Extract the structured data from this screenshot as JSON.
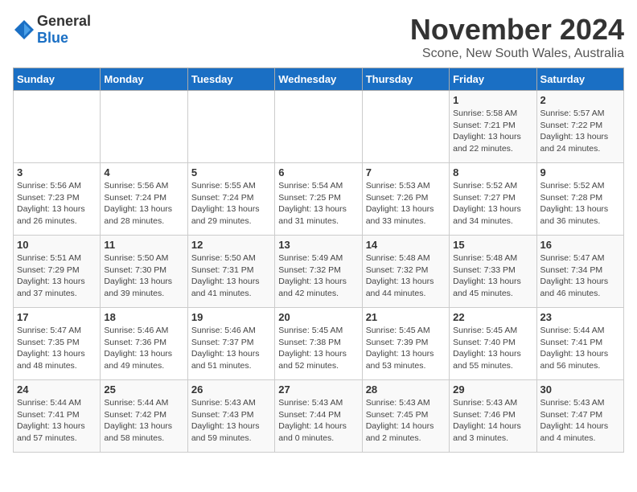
{
  "header": {
    "logo_general": "General",
    "logo_blue": "Blue",
    "month": "November 2024",
    "location": "Scone, New South Wales, Australia"
  },
  "weekdays": [
    "Sunday",
    "Monday",
    "Tuesday",
    "Wednesday",
    "Thursday",
    "Friday",
    "Saturday"
  ],
  "weeks": [
    [
      {
        "day": "",
        "info": ""
      },
      {
        "day": "",
        "info": ""
      },
      {
        "day": "",
        "info": ""
      },
      {
        "day": "",
        "info": ""
      },
      {
        "day": "",
        "info": ""
      },
      {
        "day": "1",
        "info": "Sunrise: 5:58 AM\nSunset: 7:21 PM\nDaylight: 13 hours\nand 22 minutes."
      },
      {
        "day": "2",
        "info": "Sunrise: 5:57 AM\nSunset: 7:22 PM\nDaylight: 13 hours\nand 24 minutes."
      }
    ],
    [
      {
        "day": "3",
        "info": "Sunrise: 5:56 AM\nSunset: 7:23 PM\nDaylight: 13 hours\nand 26 minutes."
      },
      {
        "day": "4",
        "info": "Sunrise: 5:56 AM\nSunset: 7:24 PM\nDaylight: 13 hours\nand 28 minutes."
      },
      {
        "day": "5",
        "info": "Sunrise: 5:55 AM\nSunset: 7:24 PM\nDaylight: 13 hours\nand 29 minutes."
      },
      {
        "day": "6",
        "info": "Sunrise: 5:54 AM\nSunset: 7:25 PM\nDaylight: 13 hours\nand 31 minutes."
      },
      {
        "day": "7",
        "info": "Sunrise: 5:53 AM\nSunset: 7:26 PM\nDaylight: 13 hours\nand 33 minutes."
      },
      {
        "day": "8",
        "info": "Sunrise: 5:52 AM\nSunset: 7:27 PM\nDaylight: 13 hours\nand 34 minutes."
      },
      {
        "day": "9",
        "info": "Sunrise: 5:52 AM\nSunset: 7:28 PM\nDaylight: 13 hours\nand 36 minutes."
      }
    ],
    [
      {
        "day": "10",
        "info": "Sunrise: 5:51 AM\nSunset: 7:29 PM\nDaylight: 13 hours\nand 37 minutes."
      },
      {
        "day": "11",
        "info": "Sunrise: 5:50 AM\nSunset: 7:30 PM\nDaylight: 13 hours\nand 39 minutes."
      },
      {
        "day": "12",
        "info": "Sunrise: 5:50 AM\nSunset: 7:31 PM\nDaylight: 13 hours\nand 41 minutes."
      },
      {
        "day": "13",
        "info": "Sunrise: 5:49 AM\nSunset: 7:32 PM\nDaylight: 13 hours\nand 42 minutes."
      },
      {
        "day": "14",
        "info": "Sunrise: 5:48 AM\nSunset: 7:32 PM\nDaylight: 13 hours\nand 44 minutes."
      },
      {
        "day": "15",
        "info": "Sunrise: 5:48 AM\nSunset: 7:33 PM\nDaylight: 13 hours\nand 45 minutes."
      },
      {
        "day": "16",
        "info": "Sunrise: 5:47 AM\nSunset: 7:34 PM\nDaylight: 13 hours\nand 46 minutes."
      }
    ],
    [
      {
        "day": "17",
        "info": "Sunrise: 5:47 AM\nSunset: 7:35 PM\nDaylight: 13 hours\nand 48 minutes."
      },
      {
        "day": "18",
        "info": "Sunrise: 5:46 AM\nSunset: 7:36 PM\nDaylight: 13 hours\nand 49 minutes."
      },
      {
        "day": "19",
        "info": "Sunrise: 5:46 AM\nSunset: 7:37 PM\nDaylight: 13 hours\nand 51 minutes."
      },
      {
        "day": "20",
        "info": "Sunrise: 5:45 AM\nSunset: 7:38 PM\nDaylight: 13 hours\nand 52 minutes."
      },
      {
        "day": "21",
        "info": "Sunrise: 5:45 AM\nSunset: 7:39 PM\nDaylight: 13 hours\nand 53 minutes."
      },
      {
        "day": "22",
        "info": "Sunrise: 5:45 AM\nSunset: 7:40 PM\nDaylight: 13 hours\nand 55 minutes."
      },
      {
        "day": "23",
        "info": "Sunrise: 5:44 AM\nSunset: 7:41 PM\nDaylight: 13 hours\nand 56 minutes."
      }
    ],
    [
      {
        "day": "24",
        "info": "Sunrise: 5:44 AM\nSunset: 7:41 PM\nDaylight: 13 hours\nand 57 minutes."
      },
      {
        "day": "25",
        "info": "Sunrise: 5:44 AM\nSunset: 7:42 PM\nDaylight: 13 hours\nand 58 minutes."
      },
      {
        "day": "26",
        "info": "Sunrise: 5:43 AM\nSunset: 7:43 PM\nDaylight: 13 hours\nand 59 minutes."
      },
      {
        "day": "27",
        "info": "Sunrise: 5:43 AM\nSunset: 7:44 PM\nDaylight: 14 hours\nand 0 minutes."
      },
      {
        "day": "28",
        "info": "Sunrise: 5:43 AM\nSunset: 7:45 PM\nDaylight: 14 hours\nand 2 minutes."
      },
      {
        "day": "29",
        "info": "Sunrise: 5:43 AM\nSunset: 7:46 PM\nDaylight: 14 hours\nand 3 minutes."
      },
      {
        "day": "30",
        "info": "Sunrise: 5:43 AM\nSunset: 7:47 PM\nDaylight: 14 hours\nand 4 minutes."
      }
    ]
  ]
}
